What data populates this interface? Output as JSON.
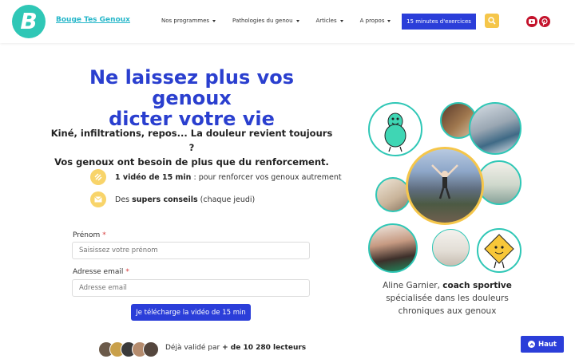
{
  "header": {
    "logo_letter": "B",
    "brand": "Bouge Tes Genoux",
    "nav": [
      {
        "label": "Nos programmes"
      },
      {
        "label": "Pathologies du genou"
      },
      {
        "label": "Articles"
      },
      {
        "label": "A propos"
      }
    ],
    "cta_label": "15 minutes d'exercices",
    "search_icon": "search-icon",
    "social": [
      {
        "icon": "youtube-icon",
        "color": "#c4132c"
      },
      {
        "icon": "pinterest-icon",
        "color": "#c4132c"
      }
    ]
  },
  "hero": {
    "title_line1": "Ne laissez plus vos genoux",
    "title_line2": "dicter votre vie",
    "subtitle_line1": "Kiné, infiltrations, repos... La douleur revient toujours ?",
    "subtitle_line2": "Vos genoux ont besoin de plus que du renforcement.",
    "bullets": [
      {
        "icon": "dumbbell-icon",
        "bold": "1 vidéo de 15 min",
        "text": " : pour renforcer vos genoux autrement"
      },
      {
        "icon": "mail-icon",
        "pre": "Des ",
        "bold": "supers conseils",
        "text": " (chaque jeudi)"
      }
    ]
  },
  "form": {
    "firstname_label": "Prénom",
    "firstname_placeholder": "Saisissez votre prénom",
    "email_label": "Adresse email",
    "email_placeholder": "Adresse email",
    "required_mark": "*",
    "submit_label": "Je télécharge la vidéo de 15 min"
  },
  "social_proof": {
    "prefix": "Déjà validé par ",
    "bold": "+ de 10 280 lecteurs"
  },
  "coach": {
    "name_prefix": "Aline Garnier, ",
    "name_bold": "coach sportive",
    "line2": "spécialisée dans les douleurs",
    "line3": "chroniques aux genoux"
  },
  "back_to_top": "Haut",
  "colors": {
    "accent": "#2b3ed9",
    "title": "#2a3fcf",
    "teal": "#2fc7b6",
    "yellow": "#f8d46a"
  }
}
